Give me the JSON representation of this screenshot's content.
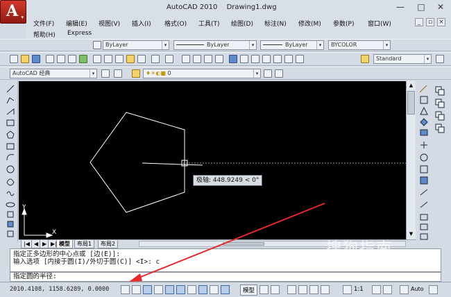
{
  "window": {
    "app_name": "AutoCAD 2010",
    "document": "Drawing1.dwg",
    "minimize": "—",
    "maximize": "□",
    "close": "✕"
  },
  "app_button": {
    "letter": "A",
    "arrow": "▾"
  },
  "menu": {
    "items": [
      "文件(F)",
      "编辑(E)",
      "视图(V)",
      "插入(I)",
      "格式(O)",
      "工具(T)",
      "绘图(D)",
      "标注(N)",
      "修改(M)",
      "参数(P)",
      "窗口(W)"
    ],
    "items_row2": [
      "帮助(H)",
      "Express"
    ],
    "doc_min": "_",
    "doc_restore": "▫",
    "doc_close": "×"
  },
  "properties_toolbar": {
    "color": "ByLayer",
    "linetype": "ByLayer",
    "lineweight": "ByLayer",
    "plotstyle": "BYCOLOR"
  },
  "styles_toolbar": {
    "text_style": "Standard"
  },
  "workspace": {
    "name": "AutoCAD 经典",
    "layer": "0"
  },
  "canvas": {
    "tooltip": "极轴: 448.9249 < 0°",
    "ucs_x": "X",
    "ucs_y": "Y"
  },
  "layout_tabs": {
    "nav": [
      "|◀",
      "◀",
      "▶",
      "▶|"
    ],
    "tabs": [
      "模型",
      "布局1",
      "布局2"
    ],
    "active": "模型"
  },
  "command": {
    "history_line1": "指定正多边形的中心点或 [边(E)]:",
    "history_line2": "输入选项 [内接于圆(I)/外切于圆(C)] <I>: c",
    "prompt": "指定圆的半径:"
  },
  "status": {
    "coordinates": "2010.4108, 1158.6289, 0.0000",
    "model_button": "模型",
    "annotation_scale": "1:1",
    "workspace_label": "Auto"
  },
  "watermark": {
    "text": "搜狗指南",
    "sub": "zhinan.sogou.com"
  },
  "colors": {
    "canvas": "#000000",
    "shape": "#ffffff",
    "arrow": "#e8282a",
    "app_button": "#c0291c"
  }
}
